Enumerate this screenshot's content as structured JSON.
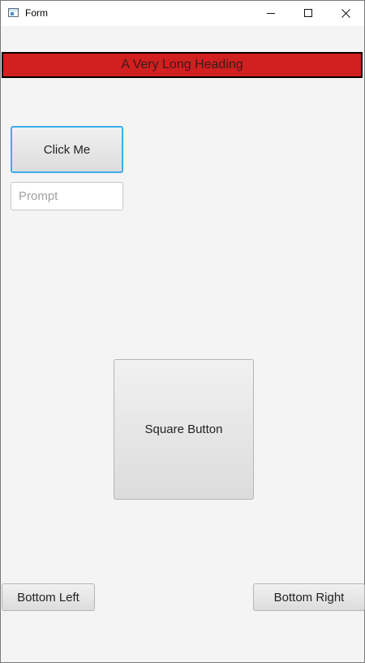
{
  "window": {
    "title": "Form",
    "controls": {
      "minimize": "—",
      "maximize": "☐",
      "close": "✕"
    }
  },
  "heading": {
    "text": "A Very Long Heading",
    "background": "#d21f1f"
  },
  "click_button": {
    "label": "Click Me"
  },
  "prompt_field": {
    "value": "",
    "placeholder": "Prompt"
  },
  "square_button": {
    "label": "Square Button"
  },
  "bottom_left_button": {
    "label": "Bottom Left"
  },
  "bottom_right_button": {
    "label": "Bottom Right"
  },
  "colors": {
    "focus_ring": "#3daee9",
    "window_bg": "#f4f4f4"
  }
}
